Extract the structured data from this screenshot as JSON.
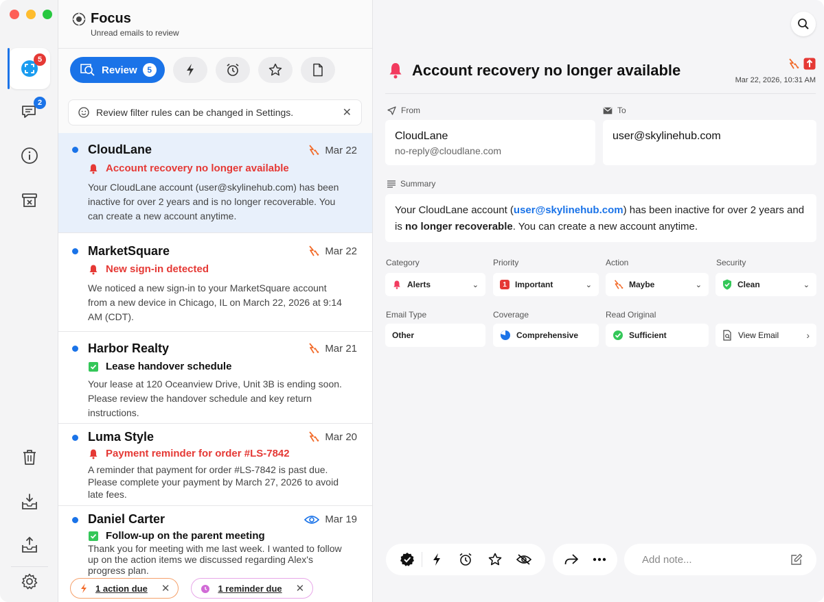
{
  "rail": {
    "focus_badge": "5",
    "messages_badge": "2"
  },
  "list": {
    "title": "Focus",
    "subtitle": "Unread emails to review",
    "review_label": "Review",
    "review_count": "5",
    "notice": "Review filter rules can be changed in Settings.",
    "emails": [
      {
        "sender": "CloudLane",
        "date": "Mar 22",
        "subject": "Account recovery no longer available",
        "preview": "Your CloudLane account (user@skylinehub.com) has been inactive for over 2 years and is no longer recoverable. You can create a new account anytime."
      },
      {
        "sender": "MarketSquare",
        "date": "Mar 22",
        "subject": "New sign-in detected",
        "preview": "We noticed a new sign-in to your MarketSquare account from a new device in Chicago, IL on March 22, 2026 at 9:14 AM (CDT)."
      },
      {
        "sender": "Harbor Realty",
        "date": "Mar 21",
        "subject": "Lease handover schedule",
        "preview": "Your lease at 120 Oceanview Drive, Unit 3B is ending soon. Please review the handover schedule and key return instructions."
      },
      {
        "sender": "Luma Style",
        "date": "Mar 20",
        "subject": "Payment reminder for order #LS-7842",
        "preview": "A reminder that payment for order #LS-7842 is past due. Please complete your payment by March 27, 2026 to avoid late fees."
      },
      {
        "sender": "Daniel Carter",
        "date": "Mar 19",
        "subject": "Follow-up on the parent meeting",
        "preview": "Thank you for meeting with me last week. I wanted to follow up on the action items we discussed regarding Alex's progress plan."
      }
    ],
    "chips": {
      "action": "1 action due",
      "reminder": "1 reminder due"
    }
  },
  "detail": {
    "title": "Account recovery no longer available",
    "datetime": "Mar 22, 2026, 10:31 AM",
    "from_label": "From",
    "to_label": "To",
    "from_name": "CloudLane",
    "from_address": "no-reply@cloudlane.com",
    "to_address": "user@skylinehub.com",
    "summary_label": "Summary",
    "summary": {
      "p1": "Your CloudLane account (",
      "email": "user@skylinehub.com",
      "p2": ") has been inactive for over 2 years and is ",
      "bold": "no longer recoverable",
      "p3": ". You can create a new account anytime."
    },
    "meta": {
      "category_label": "Category",
      "category_value": "Alerts",
      "priority_label": "Priority",
      "priority_value": "Important",
      "priority_badge": "1",
      "action_label": "Action",
      "action_value": "Maybe",
      "security_label": "Security",
      "security_value": "Clean",
      "email_type_label": "Email Type",
      "email_type_value": "Other",
      "coverage_label": "Coverage",
      "coverage_value": "Comprehensive",
      "read_original_label": "Read Original",
      "read_original_value": "Sufficient",
      "view_email_label": "View Email"
    },
    "note_placeholder": "Add note..."
  },
  "colors": {
    "accent": "#1a73e8",
    "alert_red": "#e53935",
    "action_orange": "#f26b2a",
    "ok_green": "#34c759"
  }
}
